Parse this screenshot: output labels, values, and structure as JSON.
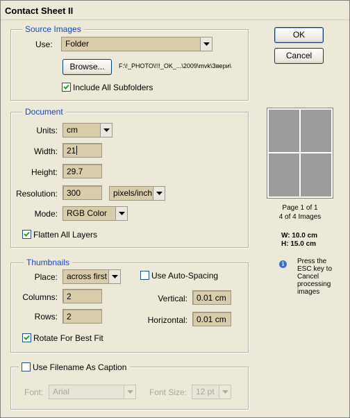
{
  "window": {
    "title": "Contact Sheet II"
  },
  "buttons": {
    "ok": "OK",
    "cancel": "Cancel",
    "browse": "Browse..."
  },
  "source": {
    "legend": "Source Images",
    "use_label": "Use:",
    "use_value": "Folder",
    "path": "F:\\!_PHOTO\\!!!_OK_...\\2009\\mvk\\Звери\\",
    "include_subfolders_label": "Include All Subfolders",
    "include_subfolders": true
  },
  "document": {
    "legend": "Document",
    "units_label": "Units:",
    "units_value": "cm",
    "width_label": "Width:",
    "width_value": "21",
    "height_label": "Height:",
    "height_value": "29.7",
    "resolution_label": "Resolution:",
    "resolution_value": "300",
    "resolution_unit": "pixels/inch",
    "mode_label": "Mode:",
    "mode_value": "RGB Color",
    "flatten_label": "Flatten All Layers",
    "flatten": true
  },
  "thumbnails": {
    "legend": "Thumbnails",
    "place_label": "Place:",
    "place_value": "across first",
    "auto_spacing_label": "Use Auto-Spacing",
    "auto_spacing": false,
    "columns_label": "Columns:",
    "columns_value": "2",
    "rows_label": "Rows:",
    "rows_value": "2",
    "vertical_label": "Vertical:",
    "vertical_value": "0.01 cm",
    "horizontal_label": "Horizontal:",
    "horizontal_value": "0.01 cm",
    "rotate_label": "Rotate For Best Fit",
    "rotate": true
  },
  "caption": {
    "use_filename_label": "Use Filename As Caption",
    "use_filename": false,
    "font_label": "Font:",
    "font_value": "Arial",
    "font_size_label": "Font Size:",
    "font_size_value": "12 pt"
  },
  "preview": {
    "page_info": "Page 1 of 1",
    "images_info": "4 of 4 Images",
    "w_info": "W: 10.0 cm",
    "h_info": "H: 15.0 cm",
    "hint": [
      "Press the",
      "ESC key to",
      "Cancel",
      "processing",
      "images"
    ]
  },
  "colors": {
    "field_bg": "#d9ccab",
    "legend_blue": "#1645c0",
    "dialog_bg": "#ece9d8"
  }
}
